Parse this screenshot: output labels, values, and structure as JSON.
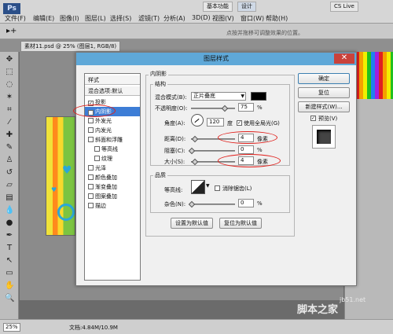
{
  "app": {
    "logo": "Ps",
    "menu": [
      "文件(F)",
      "编辑(E)",
      "图像(I)",
      "图层(L)",
      "选择(S)",
      "滤镜(T)",
      "分析(A)",
      "3D(D)",
      "视图(V)",
      "窗口(W)",
      "帮助(H)"
    ],
    "workspace_basic": "基本功能",
    "workspace_design": "设计",
    "cs_live": "CS Live",
    "options_hint": "点按并拖移可调整效果的位置。",
    "doc_tab": "素材11.psd @ 25% (图层1, RGB/8)",
    "zoom": "25%",
    "doc_size": "文档:4.84M/10.9M"
  },
  "dialog": {
    "title": "图层样式",
    "close_label": "✕",
    "style_list": {
      "header": "样式",
      "blend_options": "混合选项:默认",
      "items": [
        {
          "label": "投影",
          "checked": true,
          "selected": false,
          "indent": false
        },
        {
          "label": "内阴影",
          "checked": true,
          "selected": true,
          "indent": false
        },
        {
          "label": "外发光",
          "checked": false,
          "selected": false,
          "indent": false
        },
        {
          "label": "内发光",
          "checked": false,
          "selected": false,
          "indent": false
        },
        {
          "label": "斜面和浮雕",
          "checked": false,
          "selected": false,
          "indent": false
        },
        {
          "label": "等高线",
          "checked": false,
          "selected": false,
          "indent": true
        },
        {
          "label": "纹理",
          "checked": false,
          "selected": false,
          "indent": true
        },
        {
          "label": "光泽",
          "checked": false,
          "selected": false,
          "indent": false
        },
        {
          "label": "颜色叠加",
          "checked": false,
          "selected": false,
          "indent": false
        },
        {
          "label": "渐变叠加",
          "checked": false,
          "selected": false,
          "indent": false
        },
        {
          "label": "图案叠加",
          "checked": false,
          "selected": false,
          "indent": false
        },
        {
          "label": "描边",
          "checked": false,
          "selected": false,
          "indent": false
        }
      ]
    },
    "inner_shadow": {
      "section_title": "内阴影",
      "structure_title": "结构",
      "blend_mode_label": "混合模式(B):",
      "blend_mode_value": "正片叠底",
      "shadow_color": "#000000",
      "opacity_label": "不透明度(O):",
      "opacity_value": "75",
      "opacity_unit": "%",
      "opacity_level": 0.75,
      "angle_label": "角度(A):",
      "angle_value": "120",
      "angle_unit": "度",
      "global_light_label": "使用全局光(G)",
      "global_light_checked": true,
      "distance_label": "距离(D):",
      "distance_value": "4",
      "distance_unit": "像素",
      "choke_label": "阻塞(C):",
      "choke_value": "0",
      "choke_unit": "%",
      "size_label": "大小(S):",
      "size_value": "4",
      "size_unit": "像素",
      "quality_title": "品质",
      "contour_label": "等高线:",
      "antialias_label": "消除锯齿(L)",
      "noise_label": "杂色(N):",
      "noise_value": "0",
      "noise_unit": "%",
      "set_default": "设置为默认值",
      "reset_default": "复位为默认值"
    },
    "buttons": {
      "ok": "确定",
      "reset": "复位",
      "new_style": "新建样式(W)...",
      "preview": "预览(V)",
      "preview_checked": true
    }
  },
  "watermark": {
    "text": "脚本之家",
    "url": "jb51.net"
  },
  "colors": {
    "accent": "#3d7dd6",
    "annotation": "#e0201c",
    "title_bar": "#5fa8d8"
  }
}
